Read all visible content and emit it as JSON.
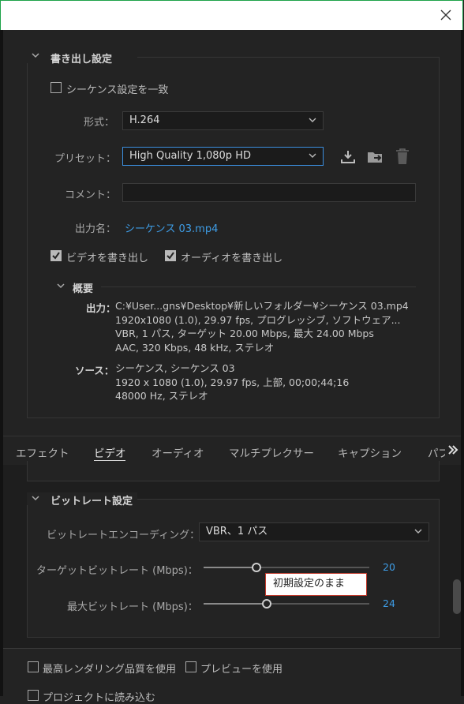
{
  "export_settings": {
    "section_title": "書き出し設定",
    "match_sequence_label": "シーケンス設定を一致",
    "format_label": "形式：",
    "format_value": "H.264",
    "preset_label": "プリセット：",
    "preset_value": "High Quality 1,080p HD",
    "comment_label": "コメント：",
    "comment_value": "",
    "output_name_label": "出力名：",
    "output_name_value": "シーケンス 03.mp4",
    "export_video_label": "ビデオを書き出し",
    "export_audio_label": "オーディオを書き出し"
  },
  "summary": {
    "title": "概要",
    "output_label": "出力：",
    "output_lines": [
      "C:¥User...gns¥Desktop¥新しいフォルダー¥シーケンス 03.mp4",
      "1920x1080 (1.0), 29.97 fps, プログレッシブ, ソフトウェア...",
      "VBR, 1 パス, ターゲット 20.00 Mbps, 最大 24.00 Mbps",
      "AAC, 320 Kbps, 48 kHz, ステレオ"
    ],
    "source_label": "ソース：",
    "source_lines": [
      "シーケンス, シーケンス 03",
      "1920 x 1080 (1.0), 29.97 fps, 上部, 00;00;44;16",
      "48000 Hz, ステレオ"
    ]
  },
  "tabs": {
    "items": [
      "エフェクト",
      "ビデオ",
      "オーディオ",
      "マルチプレクサー",
      "キャプション",
      "パブ"
    ],
    "active": "ビデオ",
    "overflow_icon": "double-chevron-right-icon"
  },
  "bitrate": {
    "section_title": "ビットレート設定",
    "encoding_label": "ビットレートエンコーディング：",
    "encoding_value": "VBR、1 パス",
    "target_label": "ターゲットビットレート (Mbps)：",
    "target_value": "20",
    "target_fraction": 0.32,
    "max_label": "最大ビットレート (Mbps)：",
    "max_value": "24",
    "max_fraction": 0.38,
    "tooltip": "初期設定のまま"
  },
  "footer": {
    "max_render_quality_label": "最高レンダリング品質を使用",
    "use_preview_label": "プレビューを使用",
    "import_to_project_label": "プロジェクトに読み込む"
  },
  "colors": {
    "accent": "#3e9de6",
    "tooltip_border": "#c0392b",
    "titlebar_border": "#1fa34a"
  }
}
